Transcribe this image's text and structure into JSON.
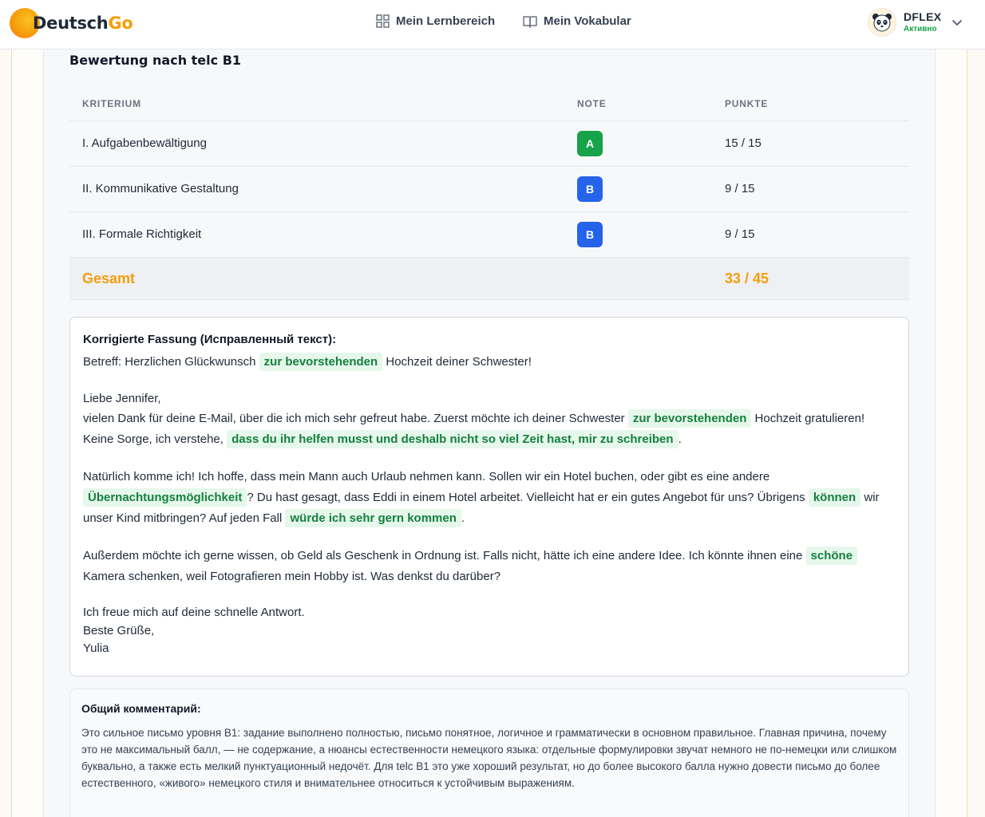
{
  "header": {
    "logo_part1": "Deutsch",
    "logo_part2": "Go",
    "nav": [
      {
        "label": "Mein Lernbereich",
        "icon": "grid-icon"
      },
      {
        "label": "Mein Vokabular",
        "icon": "book-icon"
      }
    ],
    "user": {
      "name": "DFLEX",
      "status": "Активно",
      "avatar": "panda-avatar"
    }
  },
  "colors": {
    "accent": "#f59e0b",
    "badge_a": "#16a34a",
    "badge_b": "#2563eb",
    "highlight_bg": "#e6f7ec",
    "highlight_text": "#15803d"
  },
  "evaluation": {
    "title": "Bewertung nach telc B1",
    "columns": [
      "KRITERIUM",
      "NOTE",
      "PUNKTE"
    ],
    "rows": [
      {
        "criterion": "I. Aufgabenbewältigung",
        "grade": "A",
        "points": "15 / 15"
      },
      {
        "criterion": "II. Kommunikative Gestaltung",
        "grade": "B",
        "points": "9 / 15"
      },
      {
        "criterion": "III. Formale Richtigkeit",
        "grade": "B",
        "points": "9 / 15"
      }
    ],
    "total_label": "Gesamt",
    "total_points": "33 / 45"
  },
  "corrected": {
    "title": "Korrigierte Fassung (Исправленный текст):",
    "subject_pre": "Betreff: Herzlichen Glückwunsch ",
    "subject_hl": "zur bevorstehenden",
    "subject_post": " Hochzeit deiner Schwester!",
    "greeting": "Liebe Jennifer,",
    "p1_pre": "vielen Dank für deine E-Mail, über die ich mich sehr gefreut habe. Zuerst möchte ich deiner Schwester ",
    "p1_hl1": "zur bevorstehenden",
    "p1_mid": " Hochzeit gratulieren! Keine Sorge, ich verstehe, ",
    "p1_hl2": "dass du ihr helfen musst und deshalb nicht so viel Zeit hast, mir zu schreiben",
    "p1_post": ".",
    "p2_pre": "Natürlich komme ich! Ich hoffe, dass mein Mann auch Urlaub nehmen kann. Sollen wir ein Hotel buchen, oder gibt es eine andere ",
    "p2_hl1": "Übernachtungsmöglichkeit",
    "p2_mid1": "? Du hast gesagt, dass Eddi in einem Hotel arbeitet. Vielleicht hat er ein gutes Angebot für uns? Übrigens ",
    "p2_hl2": "können",
    "p2_mid2": " wir unser Kind mitbringen? Auf jeden Fall ",
    "p2_hl3": "würde ich sehr gern kommen",
    "p2_post": ".",
    "p3_pre": "Außerdem möchte ich gerne wissen, ob Geld als Geschenk in Ordnung ist. Falls nicht, hätte ich eine andere Idee. Ich könnte ihnen eine ",
    "p3_hl": "schöne",
    "p3_post": " Kamera schenken, weil Fotografieren mein Hobby ist. Was denkst du darüber?",
    "closing1": "Ich freue mich auf deine schnelle Antwort.",
    "closing2": "Beste Grüße,",
    "signature": "Yulia"
  },
  "comment": {
    "title": "Общий комментарий:",
    "text": "Это сильное письмо уровня B1: задание выполнено полностью, письмо понятное, логичное и грамматически в основном правильное. Главная причина, почему это не максимальный балл, — не содержание, а нюансы естественности немецкого языка: отдельные формулировки звучат немного не по-немецки или слишком буквально, а также есть мелкий пунктуационный недочёт. Для telc B1 это уже хороший результат, но до более высокого балла нужно довести письмо до более естественного, «живого» немецкого стиля и внимательнее относиться к устойчивым выражениям."
  }
}
